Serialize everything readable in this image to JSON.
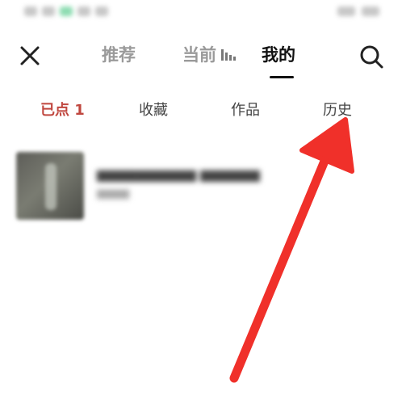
{
  "header": {
    "close_icon": "close-icon",
    "search_icon": "search-icon",
    "tabs": [
      {
        "label": "推荐"
      },
      {
        "label": "当前"
      },
      {
        "label": "我的"
      }
    ],
    "active_tab": "我的",
    "playing_indicator_icon": "equalizer-icon"
  },
  "sub_tabs": [
    {
      "label": "已点 1"
    },
    {
      "label": "收藏"
    },
    {
      "label": "作品"
    },
    {
      "label": "历史"
    }
  ],
  "active_sub_tab": "已点 1",
  "colors": {
    "accent": "#c0473f",
    "annotation_arrow": "#f0302a",
    "inactive_text": "#9a9a9a",
    "active_text": "#111111"
  },
  "annotation": {
    "type": "arrow",
    "points_to": "历史"
  }
}
